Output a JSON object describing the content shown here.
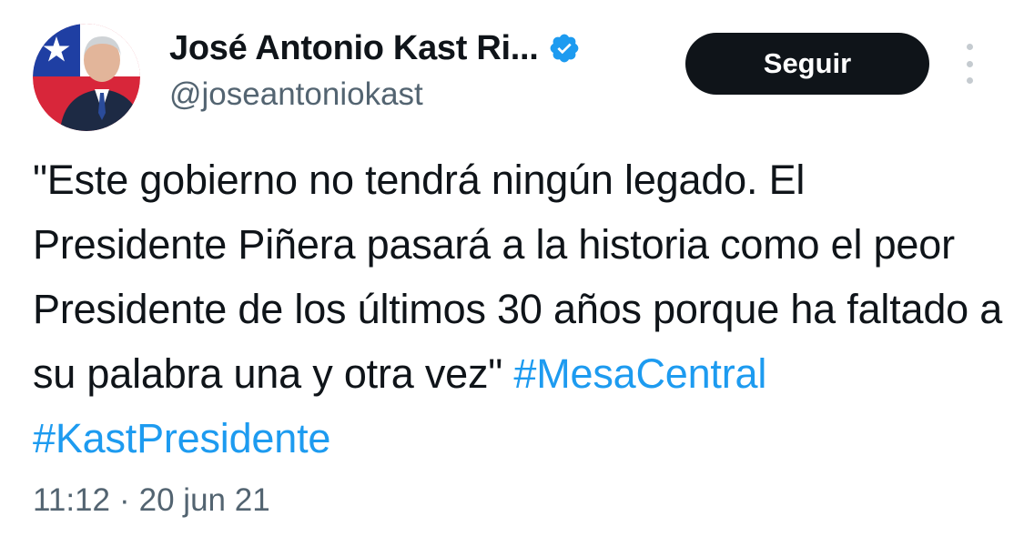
{
  "tweet": {
    "author": {
      "display_name": "José Antonio Kast Ri...",
      "handle": "@joseantoniokast",
      "verified_icon": "verified-badge-icon",
      "avatar": "avatar-photo-with-chile-flag"
    },
    "follow_button_label": "Seguir",
    "more_icon": "more-options-icon",
    "text": "\"Este gobierno no tendrá ningún legado. El Presidente Piñera pasará a la historia como el peor Presidente de los últimos 30 años porque ha faltado a su palabra una y otra vez\"",
    "hashtags": [
      "#MesaCentral",
      "#KastPresidente"
    ],
    "time": "11:12",
    "separator": "·",
    "date": "20 jun 21"
  },
  "colors": {
    "text": "#0f1419",
    "secondary": "#536471",
    "link": "#1d9bf0",
    "button_bg": "#0f1419",
    "button_text": "#ffffff",
    "verified": "#1d9bf0"
  }
}
